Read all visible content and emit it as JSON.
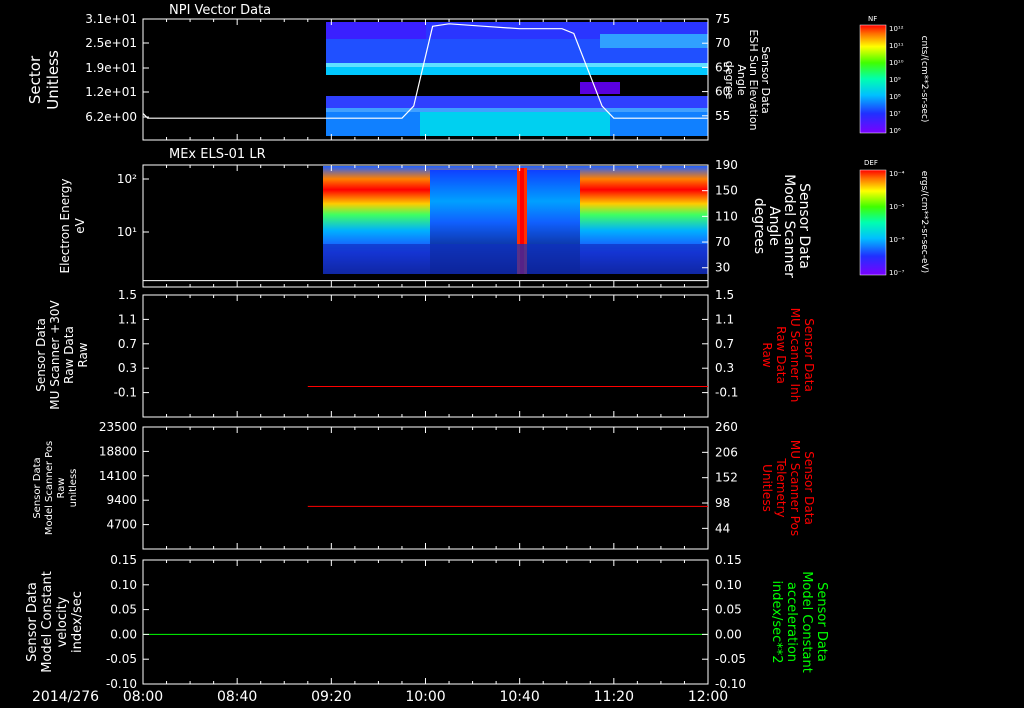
{
  "time_axis": {
    "date": "2014/276",
    "ticks": [
      "08:00",
      "08:40",
      "09:20",
      "10:00",
      "10:40",
      "11:20",
      "12:00"
    ]
  },
  "chart_data": [
    {
      "type": "heatmap",
      "title": "NPI Vector Data",
      "ylabel_left": [
        "Sector",
        "Unitless"
      ],
      "ylabel_right": [
        "Sensor Data",
        "ESH Sun Elevation",
        "Angle",
        "degree"
      ],
      "yticks_left": [
        "3.1e+01",
        "2.5e+01",
        "1.9e+01",
        "1.2e+01",
        "6.2e+00"
      ],
      "yticks_right": [
        "75",
        "70",
        "65",
        "60",
        "55"
      ],
      "ylim_right": [
        50,
        75
      ],
      "data_start": "09:13",
      "overlay_series": {
        "name": "ESH Sun Elevation Angle",
        "x": [
          "08:00",
          "08:02",
          "09:50",
          "09:55",
          "10:03",
          "10:10",
          "10:25",
          "10:40",
          "10:58",
          "11:03",
          "11:15",
          "11:20",
          "12:00"
        ],
        "y": [
          55.5,
          54.5,
          54.5,
          57,
          73.5,
          74,
          73.5,
          73,
          73,
          72,
          57,
          54.5,
          54.5
        ]
      },
      "colorbar": {
        "label": "NF",
        "unit": "cnts/(cm**2-sr-sec)",
        "ticks": [
          "10¹²",
          "10¹¹",
          "10¹⁰",
          "10⁹",
          "10⁸",
          "10⁷",
          "10⁶"
        ]
      }
    },
    {
      "type": "heatmap",
      "title": "MEx ELS-01 LR",
      "ylabel_left": [
        "Electron Energy",
        "eV"
      ],
      "ylabel_right": [
        "Sensor Data",
        "Model Scanner",
        "Angle",
        "degrees"
      ],
      "yticks_left": [
        "10²",
        "10¹"
      ],
      "yticks_right": [
        "190",
        "150",
        "110",
        "70",
        "30"
      ],
      "ylim_right": [
        0,
        190
      ],
      "data_start": "09:13",
      "overlay_series": {
        "name": "Model Scanner Angle",
        "x": [
          "08:00",
          "12:00"
        ],
        "y": [
          10,
          10
        ]
      },
      "colorbar": {
        "label": "DEF",
        "unit": "ergs/(cm**2-sr-sec-eV)",
        "ticks": [
          "10⁻⁴",
          "10⁻⁵",
          "10⁻⁶",
          "10⁻⁷"
        ]
      }
    },
    {
      "type": "line",
      "ylabel_left": [
        "Sensor Data",
        "MU Scanner +30V",
        "Raw Data",
        "Raw"
      ],
      "ylabel_right": [
        "Sensor Data",
        "MU Scanner Inh",
        "Raw Data",
        "Raw"
      ],
      "yticks": [
        "1.5",
        "1.1",
        "0.7",
        "0.3",
        "-0.1"
      ],
      "ylim": [
        -0.5,
        1.5
      ],
      "series": [
        {
          "x": [
            "09:10",
            "12:00"
          ],
          "y": [
            0.0,
            0.0
          ],
          "color": "#ff0000"
        }
      ]
    },
    {
      "type": "line",
      "ylabel_left": [
        "Sensor Data",
        "Model Scanner Pos",
        "Raw",
        "unitless"
      ],
      "ylabel_right": [
        "Sensor Data",
        "MU Scanner Pos",
        "Telemetry",
        "Unitless"
      ],
      "yticks_left": [
        "23500",
        "18800",
        "14100",
        "9400",
        "4700"
      ],
      "yticks_right": [
        "260",
        "206",
        "152",
        "98",
        "44"
      ],
      "ylim": [
        0,
        23500
      ],
      "series": [
        {
          "x": [
            "09:10",
            "12:00"
          ],
          "y": [
            8200,
            8200
          ],
          "color": "#ff0000"
        }
      ]
    },
    {
      "type": "line",
      "ylabel_left": [
        "Sensor Data",
        "Model Constant",
        "velocity",
        "index/sec"
      ],
      "ylabel_right": [
        "Sensor Data",
        "Model Constant",
        "acceleration",
        "index/sec**2"
      ],
      "yticks": [
        "0.15",
        "0.10",
        "0.05",
        "0.00",
        "-0.05",
        "-0.10"
      ],
      "ylim": [
        -0.1,
        0.15
      ],
      "series": [
        {
          "x": [
            "08:00",
            "12:00"
          ],
          "y": [
            0.0,
            0.0
          ],
          "color": "#00ff00"
        }
      ]
    }
  ],
  "colors": {
    "axis": "#ffffff",
    "red": "#ff0000",
    "green": "#00ff00"
  }
}
